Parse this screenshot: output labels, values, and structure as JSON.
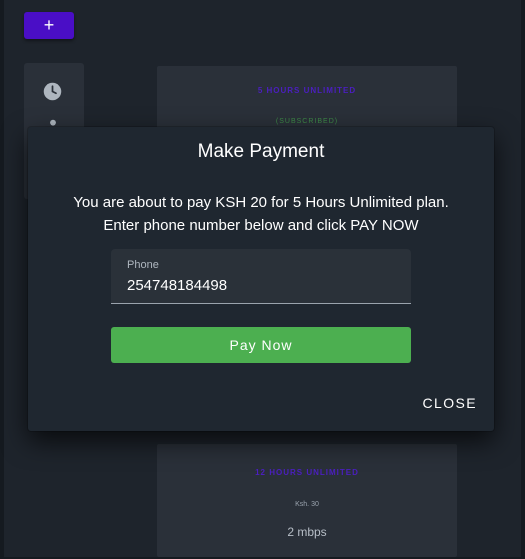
{
  "background_plans": [
    {
      "name": "5 HOURS UNLIMITED",
      "status": "(SUBSCRIBED)"
    },
    {
      "name": "12 HOURS UNLIMITED",
      "price": "Ksh. 30",
      "speed": "2 mbps"
    }
  ],
  "fab": {
    "label": "+"
  },
  "dialog": {
    "title": "Make Payment",
    "message": "You are about to pay KSH 20 for 5 Hours Unlimited plan. Enter phone number below and click PAY NOW",
    "phone_label": "Phone",
    "phone_value": "254748184498",
    "pay_button": "Pay Now",
    "close_button": "CLOSE"
  },
  "colors": {
    "accent": "#4a0ec6",
    "success": "#4caf50",
    "dialog_bg": "#1f2730",
    "page_bg": "#151a20"
  },
  "icons": [
    "clock-icon",
    "user-icon"
  ]
}
